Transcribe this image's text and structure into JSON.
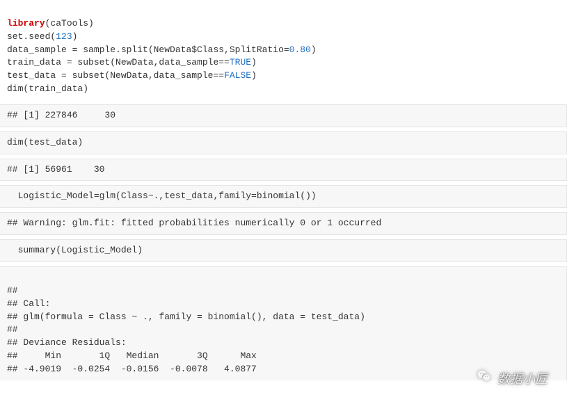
{
  "code1": {
    "l1_kw": "library",
    "l1_rest": "(caTools)",
    "l2_a": "set.seed(",
    "l2_num": "123",
    "l2_b": ")",
    "l3_a": "data_sample = sample.split(NewData$Class,SplitRatio=",
    "l3_num": "0.80",
    "l3_b": ")",
    "l4_a": "train_data = subset(NewData,data_sample==",
    "l4_bool": "TRUE",
    "l4_b": ")",
    "l5_a": "test_data = subset(NewData,data_sample==",
    "l5_bool": "FALSE",
    "l5_b": ")",
    "l6": "dim(train_data)"
  },
  "out1": "## [1] 227846     30",
  "code2": "dim(test_data)",
  "out2": "## [1] 56961    30",
  "code3": "  Logistic_Model=glm(Class~.,test_data,family=binomial())",
  "out3": "## Warning: glm.fit: fitted probabilities numerically 0 or 1 occurred",
  "code4": "  summary(Logistic_Model)",
  "out4": {
    "l1": "## ",
    "l2": "## Call:",
    "l3": "## glm(formula = Class ~ ., family = binomial(), data = test_data)",
    "l4": "## ",
    "l5": "## Deviance Residuals: ",
    "l6": "##     Min       1Q   Median       3Q      Max  ",
    "l7": "## -4.9019  -0.0254  -0.0156  -0.0078   4.0877  "
  },
  "watermark": "数据小匠"
}
